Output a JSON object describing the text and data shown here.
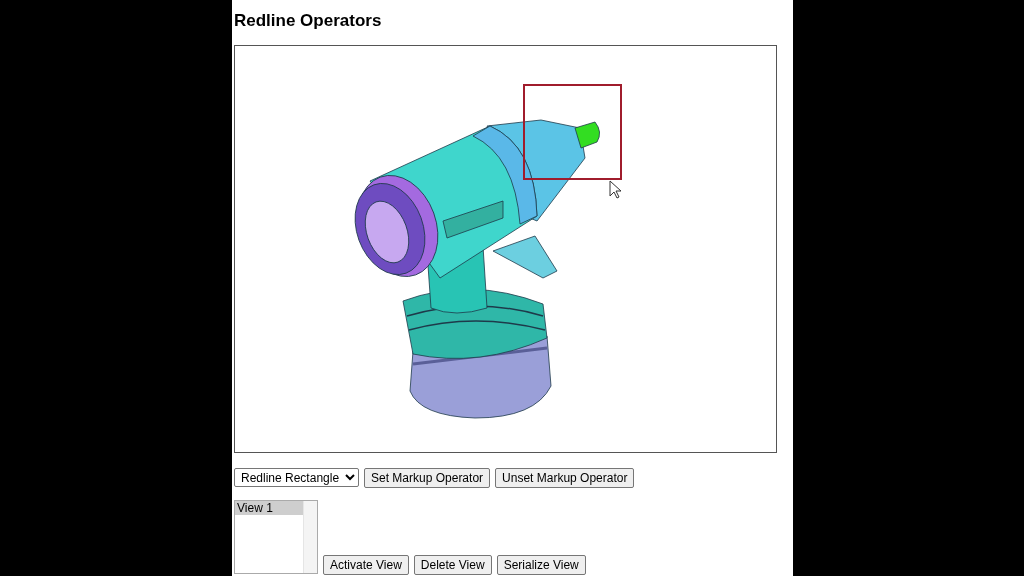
{
  "title": "Redline Operators",
  "viewer": {
    "markup_rectangle": true
  },
  "operator_select": {
    "value": "Redline Rectangle"
  },
  "operator_buttons": [
    "Set Markup Operator",
    "Unset Markup Operator"
  ],
  "views": [
    {
      "label": "View 1",
      "selected": true
    }
  ],
  "view_buttons": [
    "Activate View",
    "Delete View",
    "Serialize View"
  ]
}
